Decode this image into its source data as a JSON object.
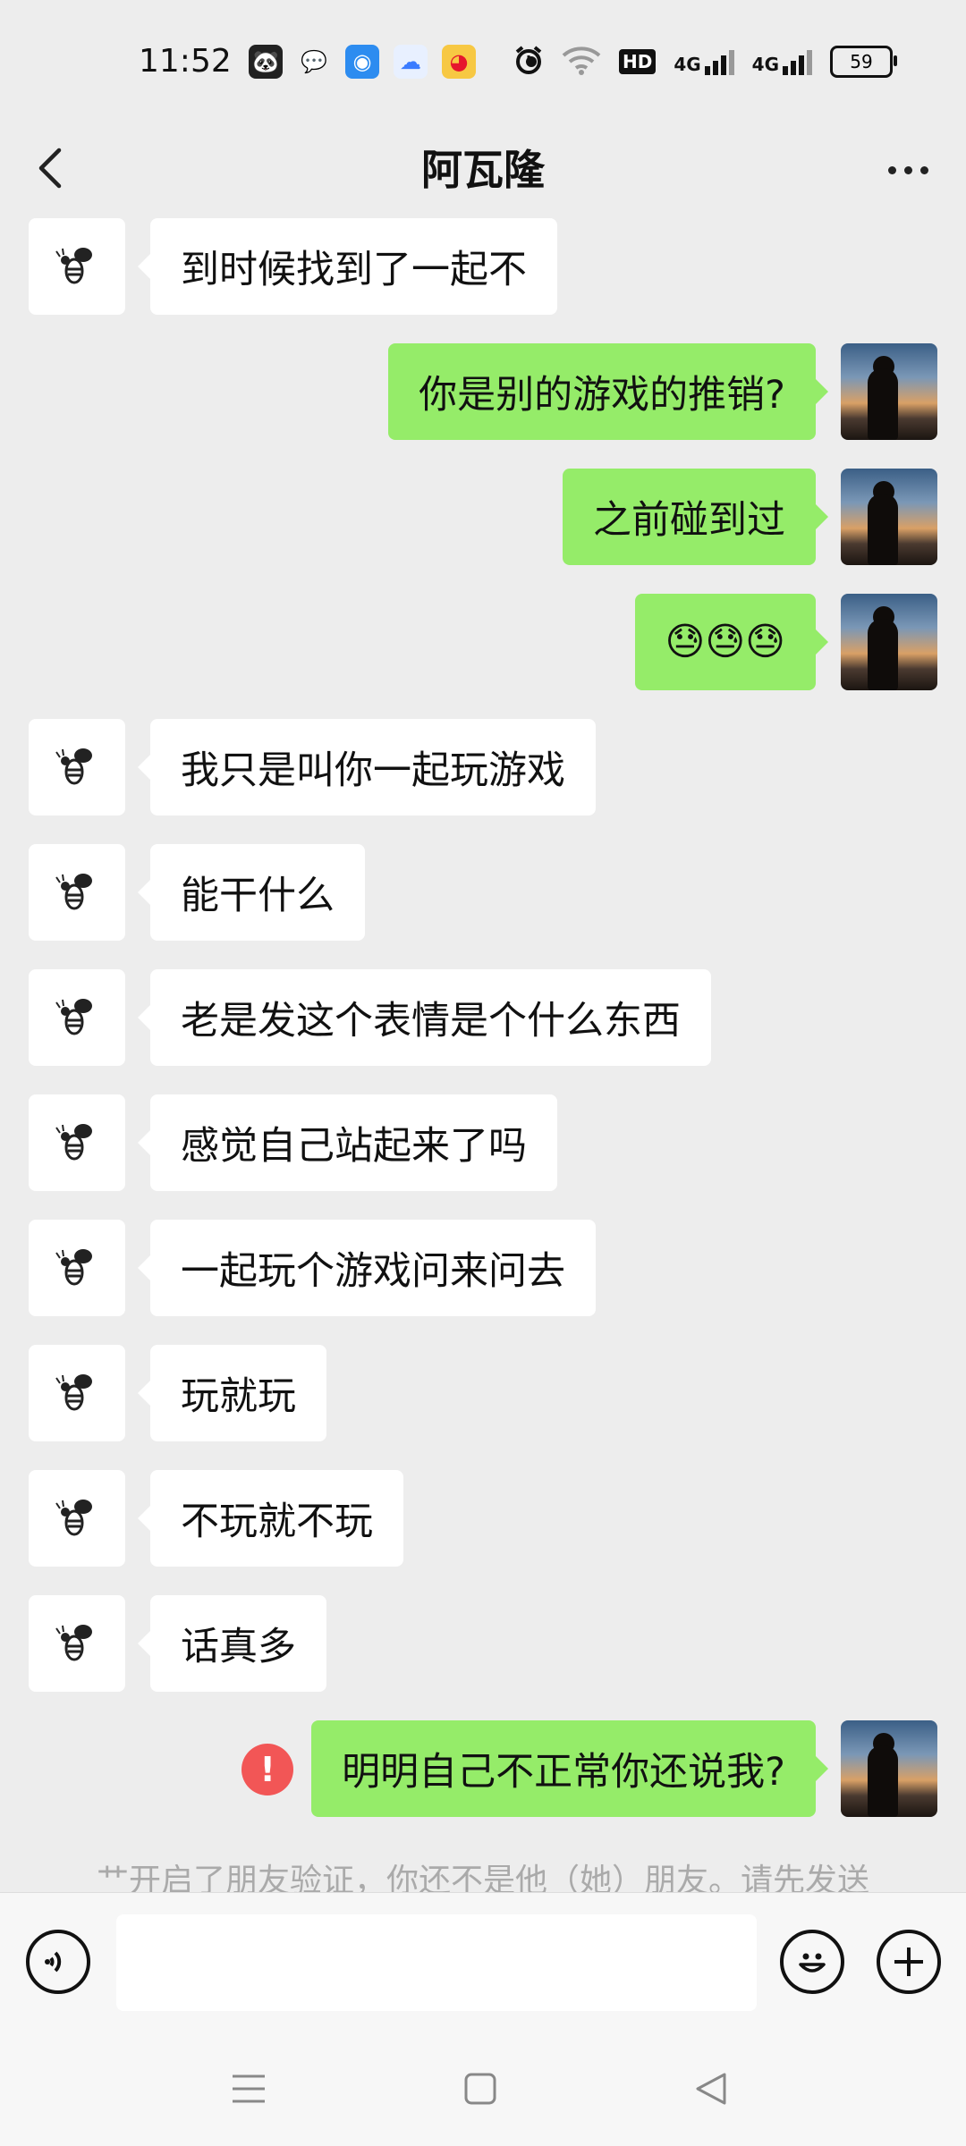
{
  "status_bar": {
    "time": "11:52",
    "battery": "59",
    "network_1": "4G",
    "network_2": "4G",
    "hd_label": "HD"
  },
  "header": {
    "title": "阿瓦隆"
  },
  "messages": [
    {
      "side": "left",
      "text": "到时候找到了一起不"
    },
    {
      "side": "right",
      "text": "你是别的游戏的推销?"
    },
    {
      "side": "right",
      "text": "之前碰到过"
    },
    {
      "side": "right",
      "text": "😓😓😓"
    },
    {
      "side": "left",
      "text": "我只是叫你一起玩游戏"
    },
    {
      "side": "left",
      "text": "能干什么"
    },
    {
      "side": "left",
      "text": "老是发这个表情是个什么东西"
    },
    {
      "side": "left",
      "text": "感觉自己站起来了吗"
    },
    {
      "side": "left",
      "text": "一起玩个游戏问来问去"
    },
    {
      "side": "left",
      "text": "玩就玩"
    },
    {
      "side": "left",
      "text": "不玩就不玩"
    },
    {
      "side": "left",
      "text": "话真多"
    },
    {
      "side": "right",
      "text": "明明自己不正常你还说我?",
      "failed": true
    }
  ],
  "system_note": "艹开启了朋友验证，你还不是他（她）朋友。请先发送",
  "input": {
    "value": "",
    "placeholder": ""
  },
  "colors": {
    "background": "#ededed",
    "bubble_self": "#95ec69",
    "bubble_other": "#ffffff",
    "error": "#f25656"
  }
}
